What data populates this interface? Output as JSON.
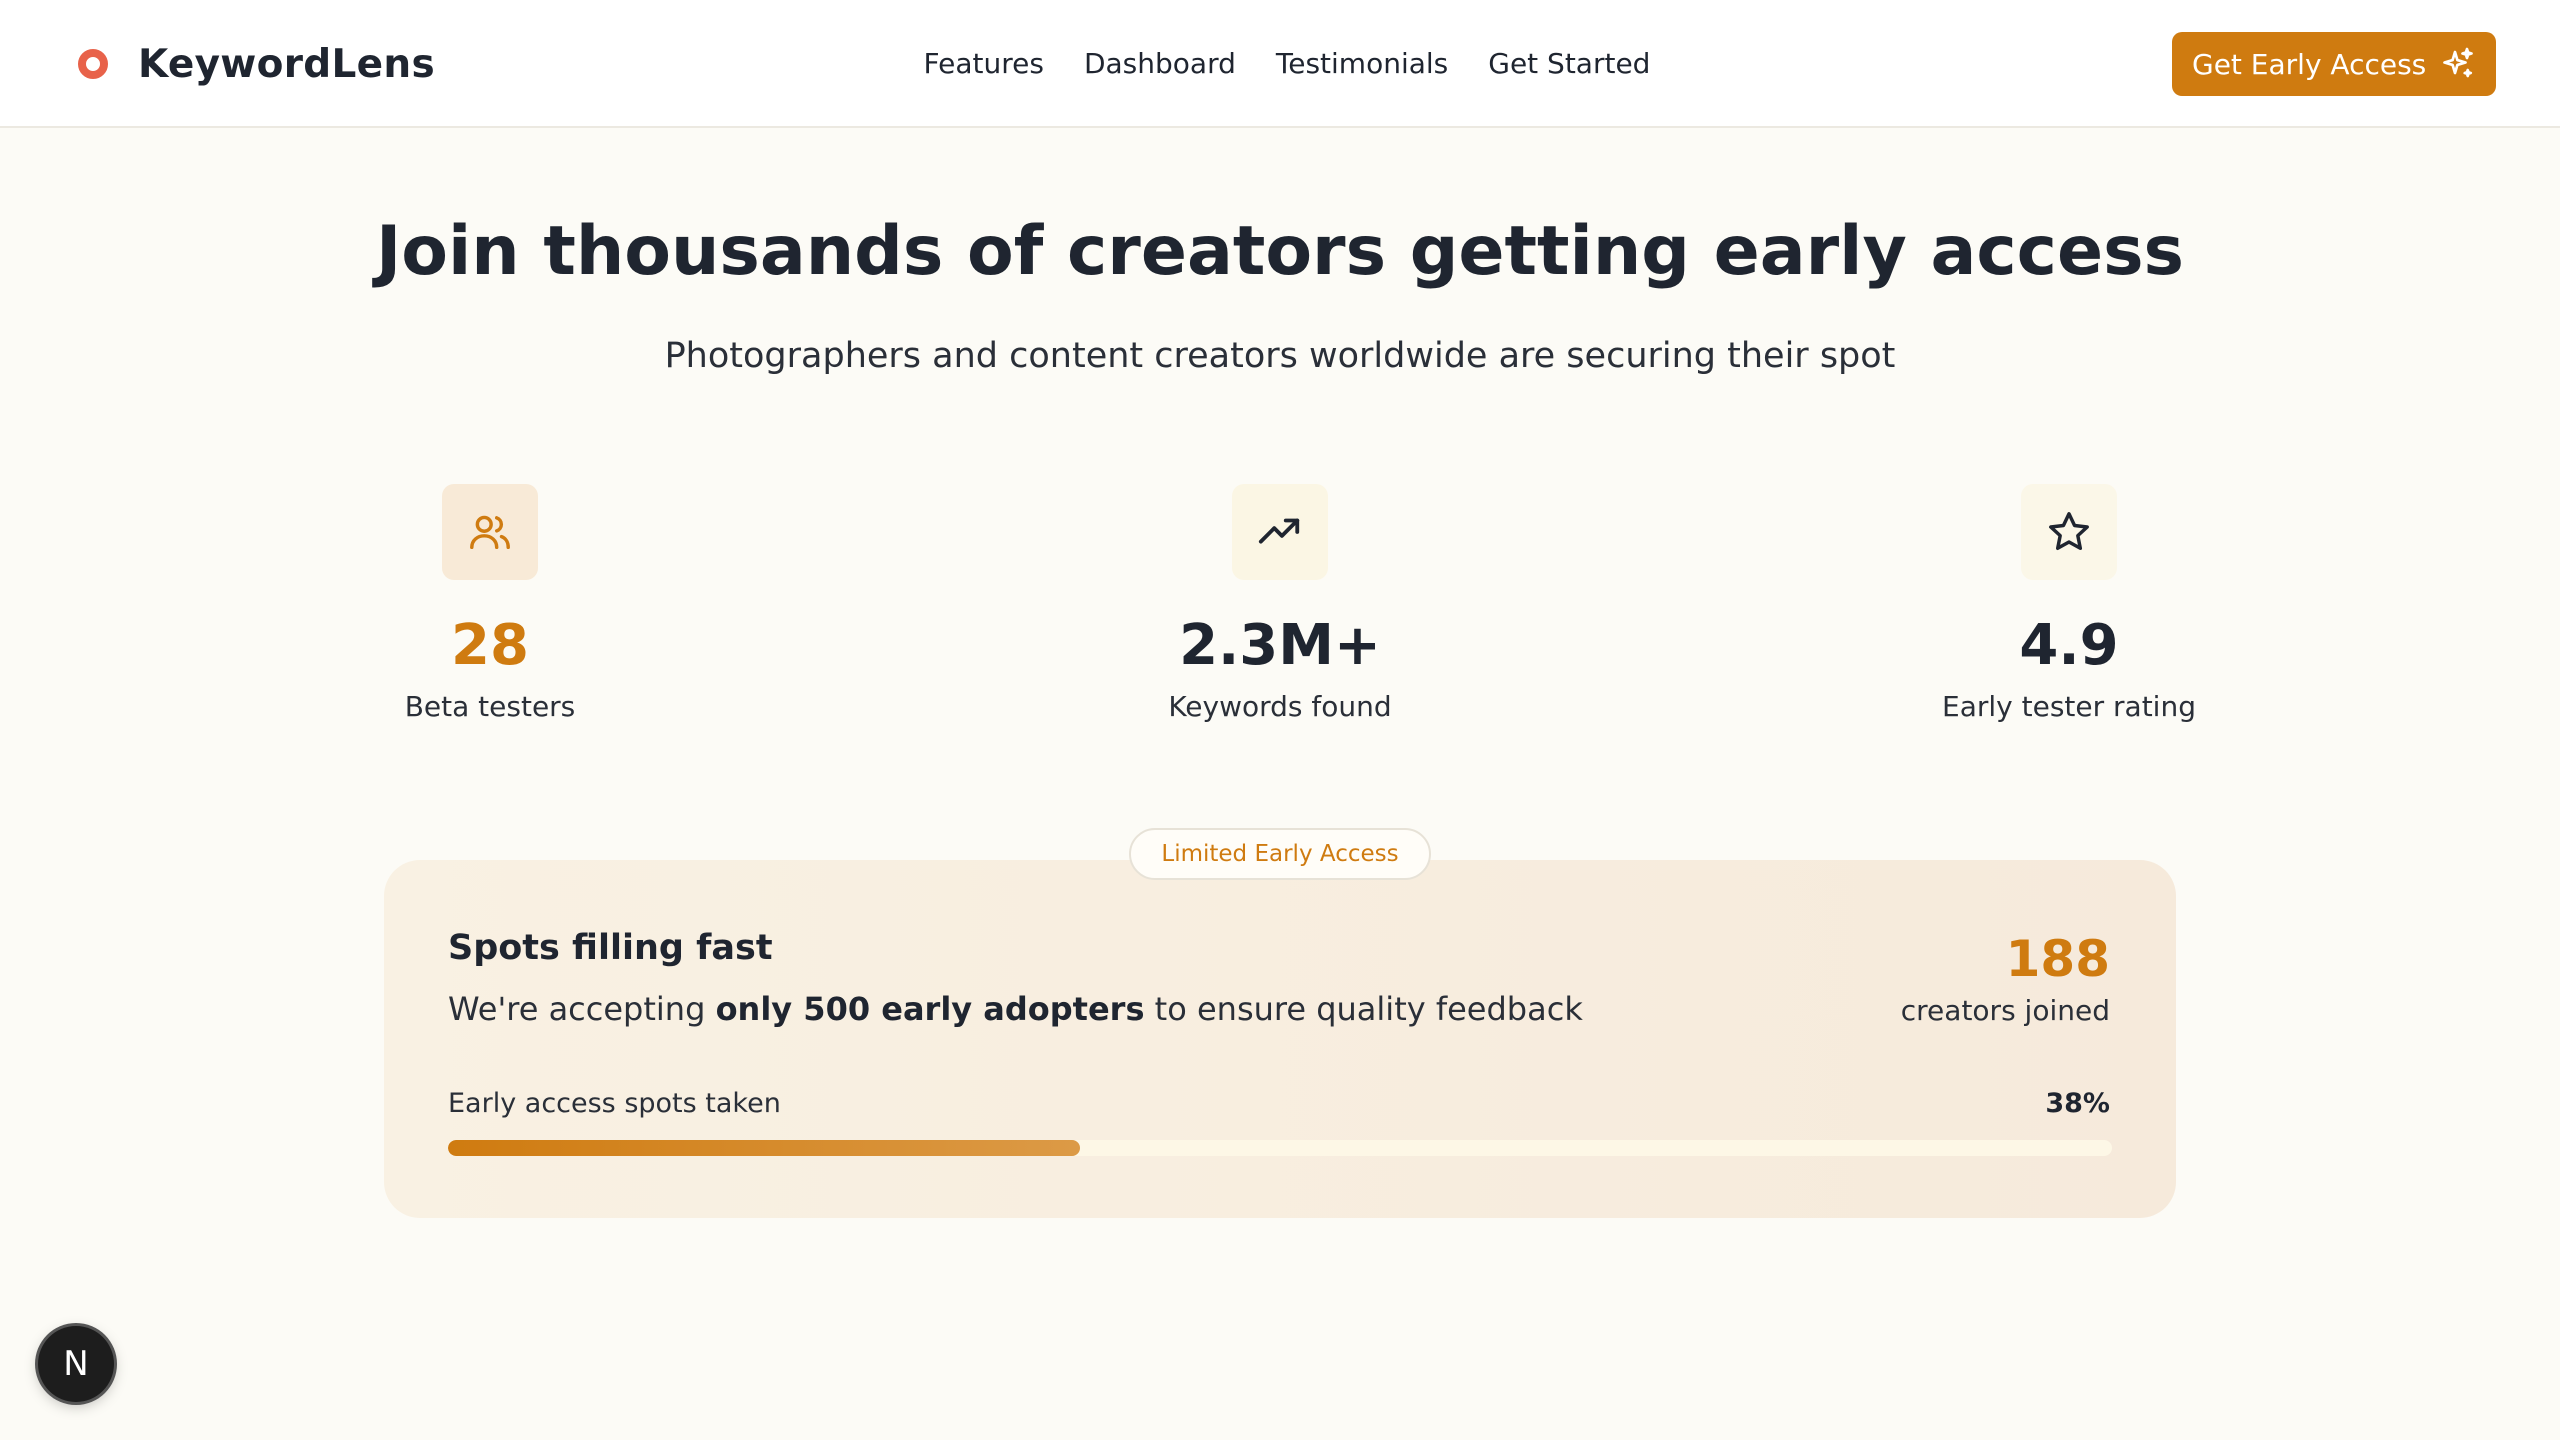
{
  "header": {
    "brand": "KeywordLens",
    "nav": [
      "Features",
      "Dashboard",
      "Testimonials",
      "Get Started"
    ],
    "cta_label": "Get Early Access",
    "cta_icon": "sparkles-icon",
    "logo_icon": "ring-logo-icon"
  },
  "hero": {
    "title": "Join thousands of creators getting early access",
    "subtitle": "Photographers and content creators worldwide are securing their spot"
  },
  "stats": [
    {
      "value": "28",
      "label": "Beta testers",
      "icon": "users-icon",
      "color": "#cf7b10"
    },
    {
      "value": "2.3M+",
      "label": "Keywords found",
      "icon": "trending-up-icon",
      "color": "#1f2530"
    },
    {
      "value": "4.9",
      "label": "Early tester rating",
      "icon": "star-icon",
      "color": "#1f2530"
    }
  ],
  "access": {
    "badge": "Limited Early Access",
    "title": "Spots filling fast",
    "desc_prefix": "We're accepting ",
    "desc_bold": "only 500 early adopters",
    "desc_suffix": " to ensure quality feedback",
    "count": "188",
    "count_label": "creators joined",
    "progress_label": "Early access spots taken",
    "progress_pct": "38%",
    "progress_fraction": 0.38
  },
  "floating_badge": "N",
  "colors": {
    "accent": "#cf7b10",
    "background": "#fcfbf6",
    "text": "#1f2530"
  }
}
